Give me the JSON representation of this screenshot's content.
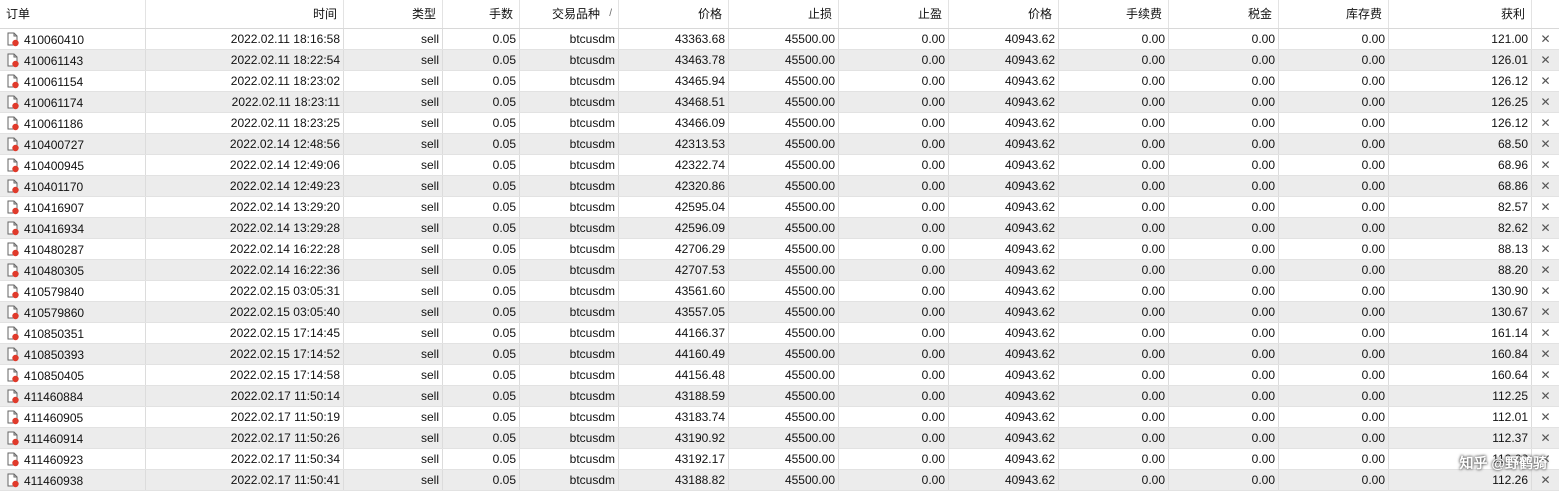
{
  "columns": {
    "order": "订单",
    "time": "时间",
    "type": "类型",
    "lots": "手数",
    "symbol": "交易品种",
    "price": "价格",
    "sl": "止损",
    "tp": "止盈",
    "cur_price": "价格",
    "commission": "手续费",
    "tax": "税金",
    "swap": "库存费",
    "profit": "获利"
  },
  "sort_indicator": "/",
  "icons": {
    "order": "order-doc-icon",
    "close": "close-icon"
  },
  "colors": {
    "alt_row": "#ececec",
    "icon_badge": "#e03a2b"
  },
  "close_glyph": "✕",
  "watermark": "知乎 @野鹤骑",
  "rows": [
    {
      "order": "410060410",
      "time": "2022.02.11 18:16:58",
      "type": "sell",
      "lots": "0.05",
      "symbol": "btcusdm",
      "price": "43363.68",
      "sl": "45500.00",
      "tp": "0.00",
      "cur_price": "40943.62",
      "commission": "0.00",
      "tax": "0.00",
      "swap": "0.00",
      "profit": "121.00"
    },
    {
      "order": "410061143",
      "time": "2022.02.11 18:22:54",
      "type": "sell",
      "lots": "0.05",
      "symbol": "btcusdm",
      "price": "43463.78",
      "sl": "45500.00",
      "tp": "0.00",
      "cur_price": "40943.62",
      "commission": "0.00",
      "tax": "0.00",
      "swap": "0.00",
      "profit": "126.01"
    },
    {
      "order": "410061154",
      "time": "2022.02.11 18:23:02",
      "type": "sell",
      "lots": "0.05",
      "symbol": "btcusdm",
      "price": "43465.94",
      "sl": "45500.00",
      "tp": "0.00",
      "cur_price": "40943.62",
      "commission": "0.00",
      "tax": "0.00",
      "swap": "0.00",
      "profit": "126.12"
    },
    {
      "order": "410061174",
      "time": "2022.02.11 18:23:11",
      "type": "sell",
      "lots": "0.05",
      "symbol": "btcusdm",
      "price": "43468.51",
      "sl": "45500.00",
      "tp": "0.00",
      "cur_price": "40943.62",
      "commission": "0.00",
      "tax": "0.00",
      "swap": "0.00",
      "profit": "126.25"
    },
    {
      "order": "410061186",
      "time": "2022.02.11 18:23:25",
      "type": "sell",
      "lots": "0.05",
      "symbol": "btcusdm",
      "price": "43466.09",
      "sl": "45500.00",
      "tp": "0.00",
      "cur_price": "40943.62",
      "commission": "0.00",
      "tax": "0.00",
      "swap": "0.00",
      "profit": "126.12"
    },
    {
      "order": "410400727",
      "time": "2022.02.14 12:48:56",
      "type": "sell",
      "lots": "0.05",
      "symbol": "btcusdm",
      "price": "42313.53",
      "sl": "45500.00",
      "tp": "0.00",
      "cur_price": "40943.62",
      "commission": "0.00",
      "tax": "0.00",
      "swap": "0.00",
      "profit": "68.50"
    },
    {
      "order": "410400945",
      "time": "2022.02.14 12:49:06",
      "type": "sell",
      "lots": "0.05",
      "symbol": "btcusdm",
      "price": "42322.74",
      "sl": "45500.00",
      "tp": "0.00",
      "cur_price": "40943.62",
      "commission": "0.00",
      "tax": "0.00",
      "swap": "0.00",
      "profit": "68.96"
    },
    {
      "order": "410401170",
      "time": "2022.02.14 12:49:23",
      "type": "sell",
      "lots": "0.05",
      "symbol": "btcusdm",
      "price": "42320.86",
      "sl": "45500.00",
      "tp": "0.00",
      "cur_price": "40943.62",
      "commission": "0.00",
      "tax": "0.00",
      "swap": "0.00",
      "profit": "68.86"
    },
    {
      "order": "410416907",
      "time": "2022.02.14 13:29:20",
      "type": "sell",
      "lots": "0.05",
      "symbol": "btcusdm",
      "price": "42595.04",
      "sl": "45500.00",
      "tp": "0.00",
      "cur_price": "40943.62",
      "commission": "0.00",
      "tax": "0.00",
      "swap": "0.00",
      "profit": "82.57"
    },
    {
      "order": "410416934",
      "time": "2022.02.14 13:29:28",
      "type": "sell",
      "lots": "0.05",
      "symbol": "btcusdm",
      "price": "42596.09",
      "sl": "45500.00",
      "tp": "0.00",
      "cur_price": "40943.62",
      "commission": "0.00",
      "tax": "0.00",
      "swap": "0.00",
      "profit": "82.62"
    },
    {
      "order": "410480287",
      "time": "2022.02.14 16:22:28",
      "type": "sell",
      "lots": "0.05",
      "symbol": "btcusdm",
      "price": "42706.29",
      "sl": "45500.00",
      "tp": "0.00",
      "cur_price": "40943.62",
      "commission": "0.00",
      "tax": "0.00",
      "swap": "0.00",
      "profit": "88.13"
    },
    {
      "order": "410480305",
      "time": "2022.02.14 16:22:36",
      "type": "sell",
      "lots": "0.05",
      "symbol": "btcusdm",
      "price": "42707.53",
      "sl": "45500.00",
      "tp": "0.00",
      "cur_price": "40943.62",
      "commission": "0.00",
      "tax": "0.00",
      "swap": "0.00",
      "profit": "88.20"
    },
    {
      "order": "410579840",
      "time": "2022.02.15 03:05:31",
      "type": "sell",
      "lots": "0.05",
      "symbol": "btcusdm",
      "price": "43561.60",
      "sl": "45500.00",
      "tp": "0.00",
      "cur_price": "40943.62",
      "commission": "0.00",
      "tax": "0.00",
      "swap": "0.00",
      "profit": "130.90"
    },
    {
      "order": "410579860",
      "time": "2022.02.15 03:05:40",
      "type": "sell",
      "lots": "0.05",
      "symbol": "btcusdm",
      "price": "43557.05",
      "sl": "45500.00",
      "tp": "0.00",
      "cur_price": "40943.62",
      "commission": "0.00",
      "tax": "0.00",
      "swap": "0.00",
      "profit": "130.67"
    },
    {
      "order": "410850351",
      "time": "2022.02.15 17:14:45",
      "type": "sell",
      "lots": "0.05",
      "symbol": "btcusdm",
      "price": "44166.37",
      "sl": "45500.00",
      "tp": "0.00",
      "cur_price": "40943.62",
      "commission": "0.00",
      "tax": "0.00",
      "swap": "0.00",
      "profit": "161.14"
    },
    {
      "order": "410850393",
      "time": "2022.02.15 17:14:52",
      "type": "sell",
      "lots": "0.05",
      "symbol": "btcusdm",
      "price": "44160.49",
      "sl": "45500.00",
      "tp": "0.00",
      "cur_price": "40943.62",
      "commission": "0.00",
      "tax": "0.00",
      "swap": "0.00",
      "profit": "160.84"
    },
    {
      "order": "410850405",
      "time": "2022.02.15 17:14:58",
      "type": "sell",
      "lots": "0.05",
      "symbol": "btcusdm",
      "price": "44156.48",
      "sl": "45500.00",
      "tp": "0.00",
      "cur_price": "40943.62",
      "commission": "0.00",
      "tax": "0.00",
      "swap": "0.00",
      "profit": "160.64"
    },
    {
      "order": "411460884",
      "time": "2022.02.17 11:50:14",
      "type": "sell",
      "lots": "0.05",
      "symbol": "btcusdm",
      "price": "43188.59",
      "sl": "45500.00",
      "tp": "0.00",
      "cur_price": "40943.62",
      "commission": "0.00",
      "tax": "0.00",
      "swap": "0.00",
      "profit": "112.25"
    },
    {
      "order": "411460905",
      "time": "2022.02.17 11:50:19",
      "type": "sell",
      "lots": "0.05",
      "symbol": "btcusdm",
      "price": "43183.74",
      "sl": "45500.00",
      "tp": "0.00",
      "cur_price": "40943.62",
      "commission": "0.00",
      "tax": "0.00",
      "swap": "0.00",
      "profit": "112.01"
    },
    {
      "order": "411460914",
      "time": "2022.02.17 11:50:26",
      "type": "sell",
      "lots": "0.05",
      "symbol": "btcusdm",
      "price": "43190.92",
      "sl": "45500.00",
      "tp": "0.00",
      "cur_price": "40943.62",
      "commission": "0.00",
      "tax": "0.00",
      "swap": "0.00",
      "profit": "112.37"
    },
    {
      "order": "411460923",
      "time": "2022.02.17 11:50:34",
      "type": "sell",
      "lots": "0.05",
      "symbol": "btcusdm",
      "price": "43192.17",
      "sl": "45500.00",
      "tp": "0.00",
      "cur_price": "40943.62",
      "commission": "0.00",
      "tax": "0.00",
      "swap": "0.00",
      "profit": "112.62"
    },
    {
      "order": "411460938",
      "time": "2022.02.17 11:50:41",
      "type": "sell",
      "lots": "0.05",
      "symbol": "btcusdm",
      "price": "43188.82",
      "sl": "45500.00",
      "tp": "0.00",
      "cur_price": "40943.62",
      "commission": "0.00",
      "tax": "0.00",
      "swap": "0.00",
      "profit": "112.26"
    }
  ]
}
